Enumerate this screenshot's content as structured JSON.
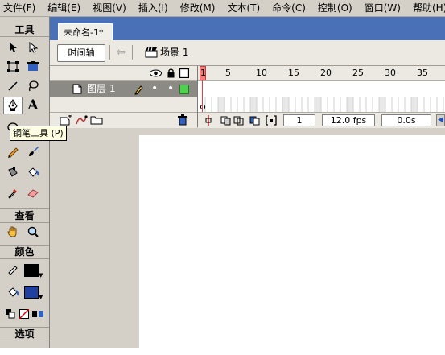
{
  "menubar": {
    "items": [
      {
        "label": "文件(F)"
      },
      {
        "label": "编辑(E)"
      },
      {
        "label": "视图(V)"
      },
      {
        "label": "插入(I)"
      },
      {
        "label": "修改(M)"
      },
      {
        "label": "文本(T)"
      },
      {
        "label": "命令(C)"
      },
      {
        "label": "控制(O)"
      },
      {
        "label": "窗口(W)"
      },
      {
        "label": "帮助(H)"
      }
    ]
  },
  "tools": {
    "title": "工具",
    "view_title": "查看",
    "colors_title": "颜色",
    "options_title": "选项",
    "tooltip": "钢笔工具 (P)",
    "stroke_color": "#000000",
    "fill_color": "#2040a0",
    "text_tool_glyph": "A"
  },
  "document": {
    "tab_title": "未命名-1*",
    "timeline_button": "时间轴",
    "scene_label": "场景 1"
  },
  "timeline": {
    "frame_numbers": [
      "1",
      "5",
      "10",
      "15",
      "20",
      "25",
      "30",
      "35"
    ],
    "layer_name": "图层 1",
    "current_frame": "1",
    "frame_rate": "12.0 fps",
    "elapsed_time": "0.0s"
  }
}
